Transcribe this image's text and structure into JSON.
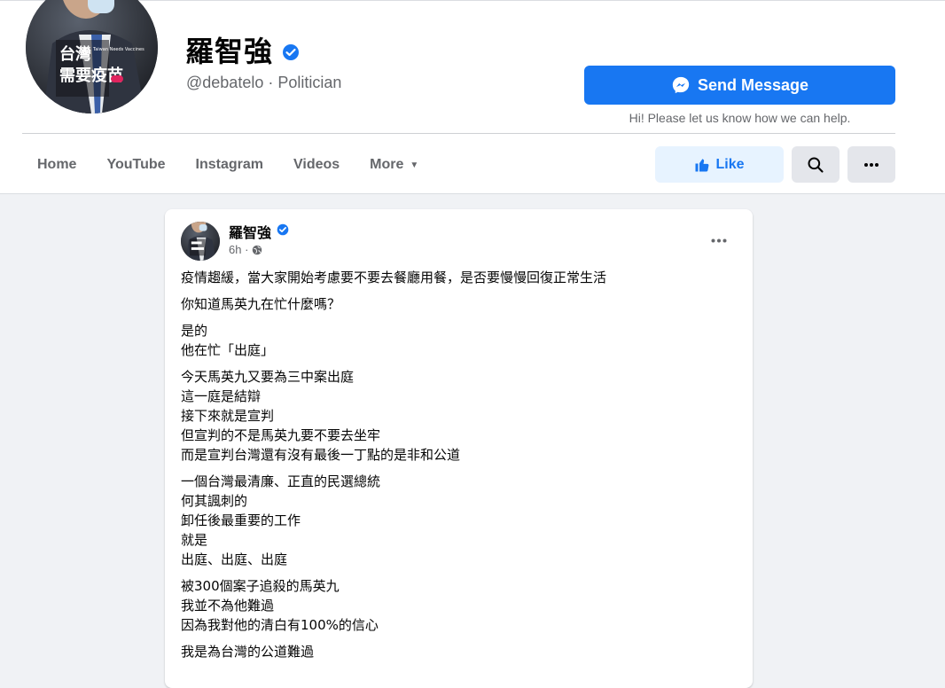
{
  "profile": {
    "name": "羅智強",
    "handle": "@debatelo · Politician",
    "avatar_text_top": "台灣",
    "avatar_text_sub": "Taiwan Needs Vaccines",
    "avatar_text_bottom": "需要疫苗"
  },
  "actions": {
    "send_message_label": "Send Message",
    "helper_text": "Hi! Please let us know how we can help.",
    "like_label": "Like"
  },
  "nav": {
    "items": [
      {
        "label": "Home"
      },
      {
        "label": "YouTube"
      },
      {
        "label": "Instagram"
      },
      {
        "label": "Videos"
      },
      {
        "label": "More"
      }
    ]
  },
  "post": {
    "author": "羅智強",
    "time": "6h ·",
    "paragraphs": [
      [
        "疫情趨緩，當大家開始考慮要不要去餐廳用餐，是否要慢慢回復正常生活"
      ],
      [
        "你知道馬英九在忙什麼嗎？"
      ],
      [
        "是的",
        "他在忙「出庭」"
      ],
      [
        "今天馬英九又要為三中案出庭",
        "這一庭是結辯",
        "接下來就是宣判",
        "但宣判的不是馬英九要不要去坐牢",
        "而是宣判台灣還有沒有最後一丁點的是非和公道"
      ],
      [
        "一個台灣最清廉、正直的民選總統",
        "何其諷刺的",
        "卸任後最重要的工作",
        "就是",
        "出庭、出庭、出庭"
      ],
      [
        "被300個案子追殺的馬英九",
        "我並不為他難過",
        "因為我對他的清白有100%的信心"
      ],
      [
        "我是為台灣的公道難過"
      ]
    ]
  },
  "colors": {
    "brand": "#1877f2",
    "page_bg": "#f0f2f5",
    "secondary_text": "#65676b"
  }
}
